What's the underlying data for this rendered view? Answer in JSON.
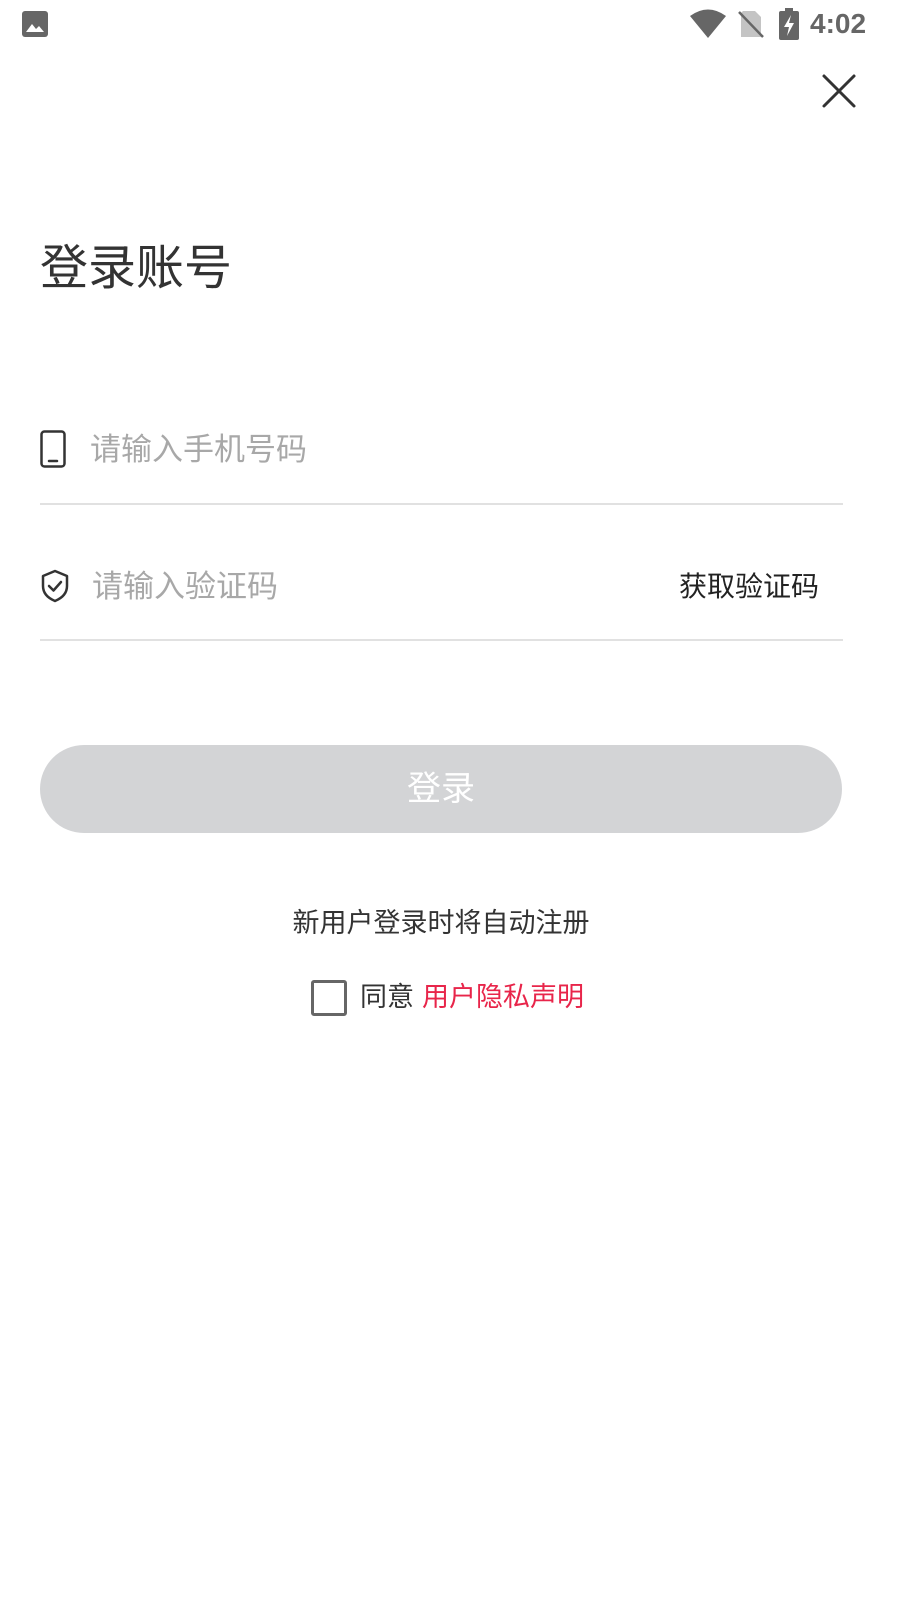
{
  "status_bar": {
    "time": "4:02",
    "icons": [
      "gallery-icon",
      "wifi-icon",
      "no-sim-icon",
      "battery-charging-icon"
    ],
    "icon_color": "#666666"
  },
  "close": {
    "icon": "close-icon"
  },
  "title": "登录账号",
  "phone_field": {
    "icon": "phone-icon",
    "placeholder": "请输入手机号码",
    "value": ""
  },
  "code_field": {
    "icon": "shield-check-icon",
    "placeholder": "请输入验证码",
    "value": "",
    "get_code_label": "获取验证码"
  },
  "login_button": {
    "label": "登录",
    "background": "#d3d4d6",
    "enabled": false
  },
  "auto_register_hint": "新用户登录时将自动注册",
  "agreement": {
    "checked": false,
    "prefix": "同意",
    "link_label": "用户隐私声明",
    "link_color": "#e8254a"
  }
}
